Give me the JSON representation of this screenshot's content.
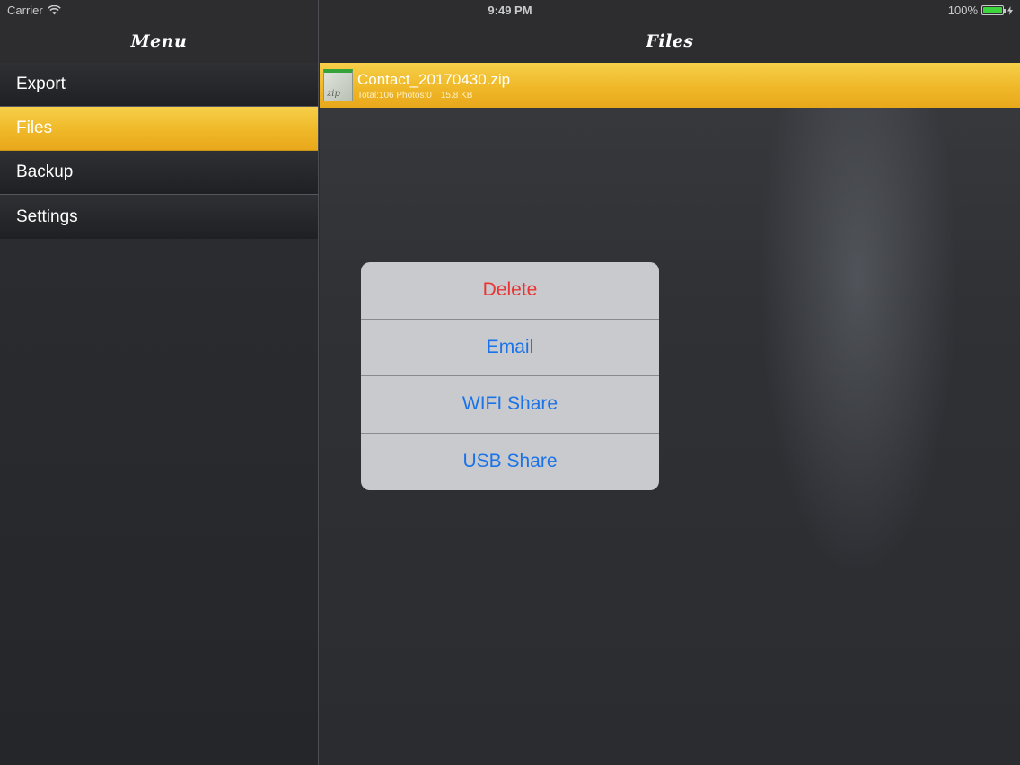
{
  "status_bar": {
    "carrier": "Carrier",
    "time": "9:49 PM",
    "battery_percent": "100%",
    "battery_level": 1.0
  },
  "sidebar": {
    "title": "Menu",
    "items": [
      {
        "label": "Export"
      },
      {
        "label": "Files"
      },
      {
        "label": "Backup"
      },
      {
        "label": "Settings"
      }
    ],
    "selected_index": 1
  },
  "main": {
    "title": "Files",
    "files": [
      {
        "name": "Contact_20170430.zip",
        "meta": "Total:106 Photos:0",
        "size": "15.8 KB",
        "icon": "zip-file-icon",
        "icon_label": "zip"
      }
    ]
  },
  "action_sheet": {
    "items": [
      {
        "label": "Delete",
        "style": "destructive"
      },
      {
        "label": "Email"
      },
      {
        "label": "WIFI Share"
      },
      {
        "label": "USB Share"
      }
    ]
  },
  "colors": {
    "accent_yellow": "#efb828",
    "action_blue": "#1a73e8",
    "destructive_red": "#ea3434",
    "battery_green": "#3ed43e"
  }
}
